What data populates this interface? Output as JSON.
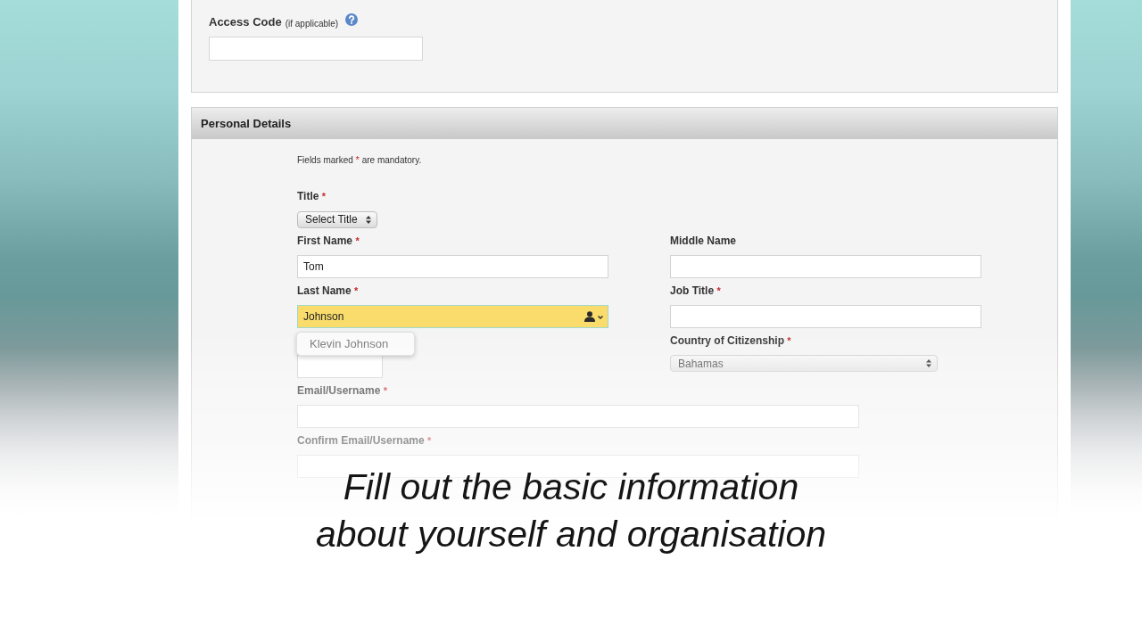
{
  "access_code": {
    "label": "Access Code",
    "hint": "(if applicable)"
  },
  "personal_details": {
    "title": "Personal Details",
    "required_mark": "*",
    "note_start": "Fields marked",
    "note_end": "are mandatory.",
    "rows": [
      [
        {
          "kind": "compact-select",
          "label": "Title",
          "required": true,
          "value": "Select Title"
        }
      ],
      [
        {
          "kind": "text",
          "label": "First Name",
          "required": true,
          "value": "Tom",
          "autofilled": false
        },
        {
          "kind": "text",
          "label": "Middle Name",
          "required": false,
          "autofilled": false
        }
      ],
      [
        {
          "kind": "text",
          "label": "Last Name",
          "required": true,
          "value": "Johnson",
          "autofilled": true,
          "suggestions": [
            "Klevin Johnson"
          ]
        },
        {
          "kind": "text",
          "label": "Job Title",
          "required": true,
          "autofilled": false
        }
      ],
      [
        {
          "kind": "short-text",
          "autofilled": false
        },
        {
          "kind": "select",
          "label": "Country of Citizenship",
          "required": true,
          "value": "Bahamas"
        }
      ],
      [
        {
          "kind": "wide-text",
          "label": "Email/Username",
          "required": true,
          "autofilled": false
        }
      ],
      [
        {
          "kind": "wide-text",
          "label": "Confirm Email/Username",
          "required": true,
          "autofilled": false
        }
      ]
    ]
  },
  "caption": [
    "Fill out the basic information",
    "about yourself and organisation"
  ]
}
